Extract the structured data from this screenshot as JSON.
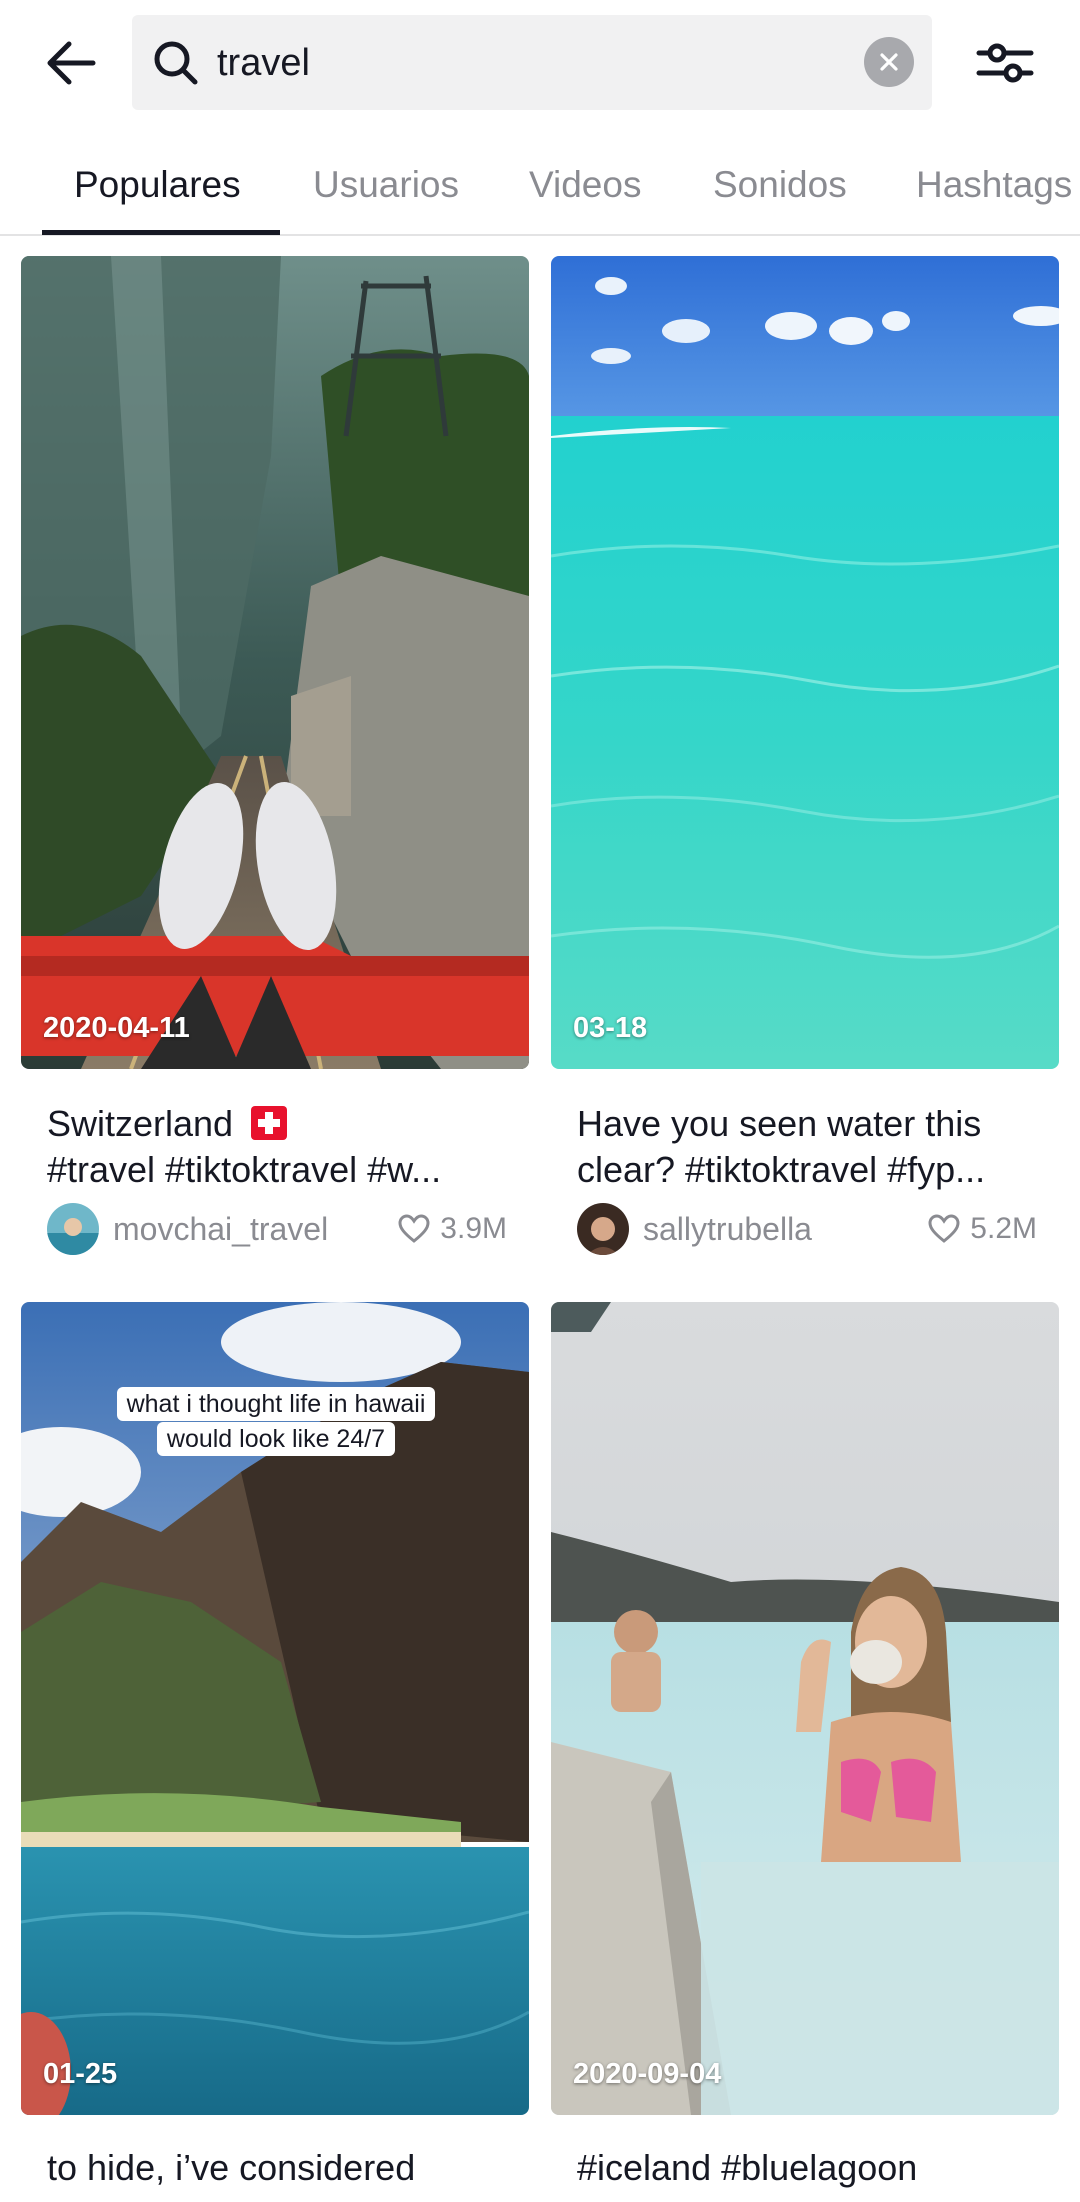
{
  "search": {
    "query": "travel"
  },
  "tabs": [
    {
      "label": "Populares",
      "active": true
    },
    {
      "label": "Usuarios",
      "active": false
    },
    {
      "label": "Videos",
      "active": false
    },
    {
      "label": "Sonidos",
      "active": false
    },
    {
      "label": "Hashtags",
      "active": false
    }
  ],
  "videos": [
    {
      "date": "2020-04-11",
      "caption_line1": "Switzerland",
      "caption_line2": "#travel #tiktoktravel #w...",
      "username": "movchai_travel",
      "likes": "3.9M"
    },
    {
      "date": "03-18",
      "caption_line1": "Have you seen water this",
      "caption_line2": "clear? #tiktoktravel #fyp...",
      "username": "sallytrubella",
      "likes": "5.2M"
    },
    {
      "date": "01-25",
      "overlay_line1": "what i thought life in hawaii",
      "overlay_line2": "would look like 24/7",
      "caption_line1": "to hide, i’ve considered"
    },
    {
      "date": "2020-09-04",
      "caption_line1": "#iceland #bluelagoon"
    }
  ],
  "icons": {
    "back": "arrow-left-icon",
    "search": "magnifier-icon",
    "clear": "x-circle-icon",
    "filter": "sliders-icon",
    "like": "heart-outline-icon",
    "flag": "swiss-flag-icon"
  },
  "colors": {
    "text": "#161823",
    "muted": "#8a8b91",
    "search_bg": "#f1f1f2",
    "swiss_red": "#e8112d"
  }
}
